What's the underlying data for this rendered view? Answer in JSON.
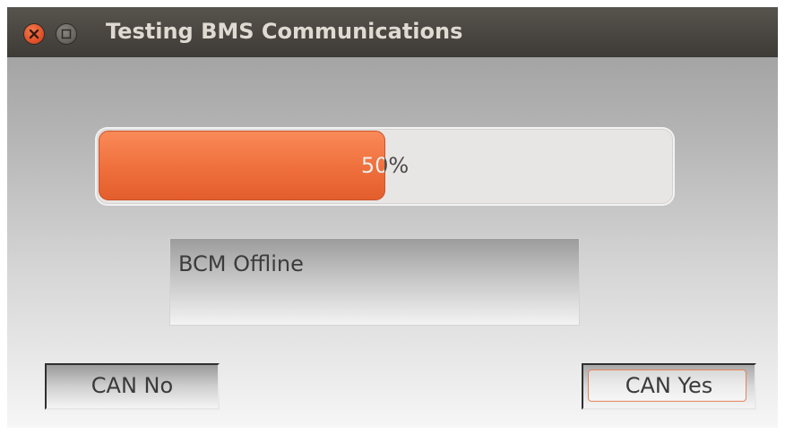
{
  "window": {
    "title": "Testing BMS Communications",
    "close_icon": "close-icon",
    "maximize_icon": "maximize-icon"
  },
  "progress": {
    "value": 0.5,
    "label": "50%",
    "fill_color": "#f07540"
  },
  "status": {
    "text": "BCM Offline"
  },
  "buttons": {
    "can_no": "CAN No",
    "can_yes": "CAN Yes"
  },
  "colors": {
    "accent": "#f07540",
    "titlebar": "#3e3b37"
  }
}
